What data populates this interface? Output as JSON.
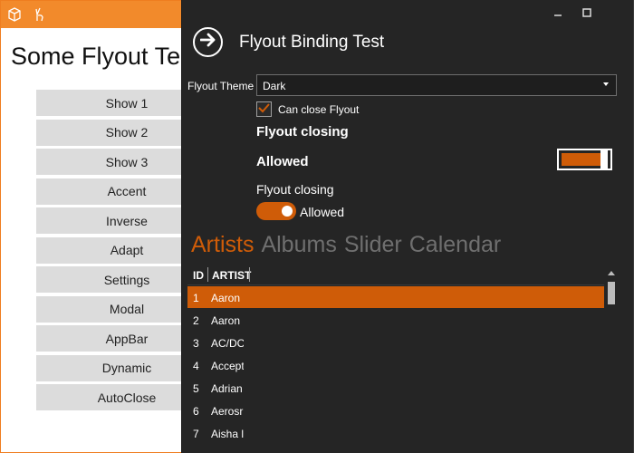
{
  "main": {
    "heading": "Some Flyout Te",
    "buttons": [
      "Show 1",
      "Show 2",
      "Show 3",
      "Accent",
      "Inverse",
      "Adapt",
      "Settings",
      "Modal",
      "AppBar",
      "Dynamic",
      "AutoClose"
    ]
  },
  "title_bar": {
    "icons": [
      "cube-icon",
      "hand-icon"
    ]
  },
  "flyout": {
    "title": "Flyout Binding Test",
    "back_icon": "arrow-right-icon",
    "window_controls": [
      "minimize-icon",
      "maximize-icon"
    ],
    "theme_label": "Flyout Theme",
    "theme_value": "Dark",
    "can_close_label": "Can close Flyout",
    "can_close_checked": true,
    "closing_header_1": "Flyout closing",
    "allowed_text_1": "Allowed",
    "closing_header_2": "Flyout closing",
    "allowed_text_2": "Allowed",
    "tabs": [
      "Artists",
      "Albums",
      "Slider",
      "Calendar"
    ],
    "active_tab": "Artists",
    "grid": {
      "columns": [
        "ID",
        "ARTIST"
      ],
      "rows": [
        {
          "id": "1",
          "artist": "Aaron"
        },
        {
          "id": "2",
          "artist": "Aaron"
        },
        {
          "id": "3",
          "artist": "AC/DC"
        },
        {
          "id": "4",
          "artist": "Accept"
        },
        {
          "id": "5",
          "artist": "Adrian"
        },
        {
          "id": "6",
          "artist": "Aerosr"
        },
        {
          "id": "7",
          "artist": "Aisha l"
        }
      ],
      "selected_row": 0
    }
  },
  "colors": {
    "accent": "#cf5c08",
    "title_bar": "#f28a2b",
    "flyout_bg": "#252525"
  }
}
